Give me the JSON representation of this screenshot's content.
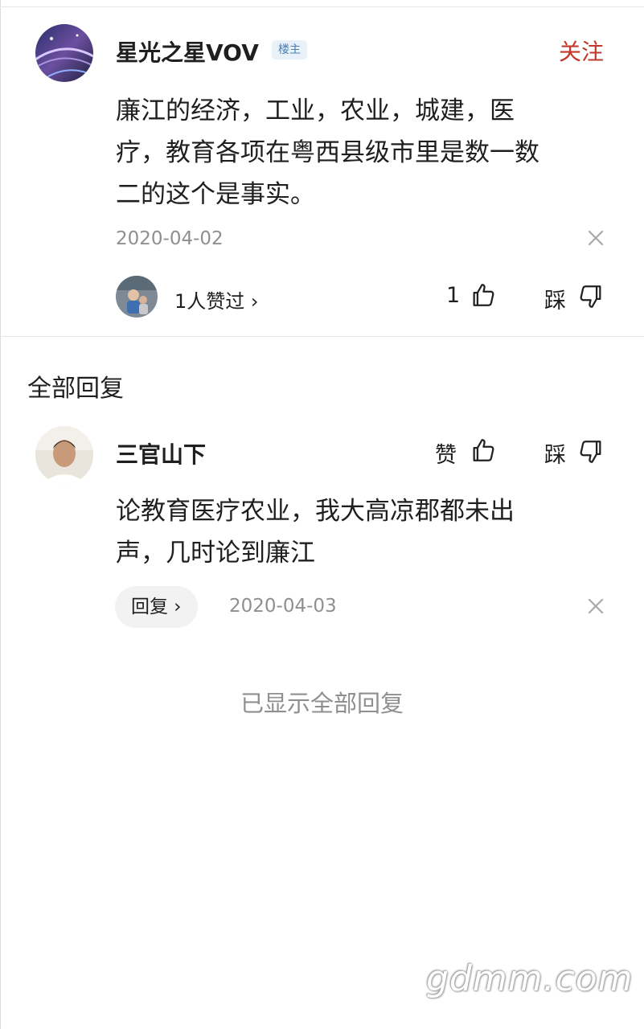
{
  "main_comment": {
    "username": "星光之星VOV",
    "author_badge": "楼主",
    "follow_label": "关注",
    "content": [
      "廉江的经济，工业，农业，城建，医",
      "疗，教育各项在粤西县级市里是数一数",
      "二的这个是事实。"
    ],
    "date": "2020-04-02",
    "likers_label": "1人赞过 ›",
    "like_count": "1",
    "dislike_label": "踩"
  },
  "replies_section": {
    "title": "全部回复",
    "reply": {
      "username": "三官山下",
      "like_label": "赞",
      "dislike_label": "踩",
      "content": [
        "论教育医疗农业，我大高凉郡都未出",
        "声，几时论到廉江"
      ],
      "reply_button_label": "回复 ›",
      "date": "2020-04-03"
    },
    "end_note": "已显示全部回复"
  },
  "watermark": "gdmm.com",
  "colors": {
    "follow": "#c0392b",
    "badge_bg": "#e8f0f8",
    "badge_text": "#4a7fb5"
  },
  "icons": [
    "thumbs-up-icon",
    "thumbs-down-icon",
    "close-icon"
  ]
}
